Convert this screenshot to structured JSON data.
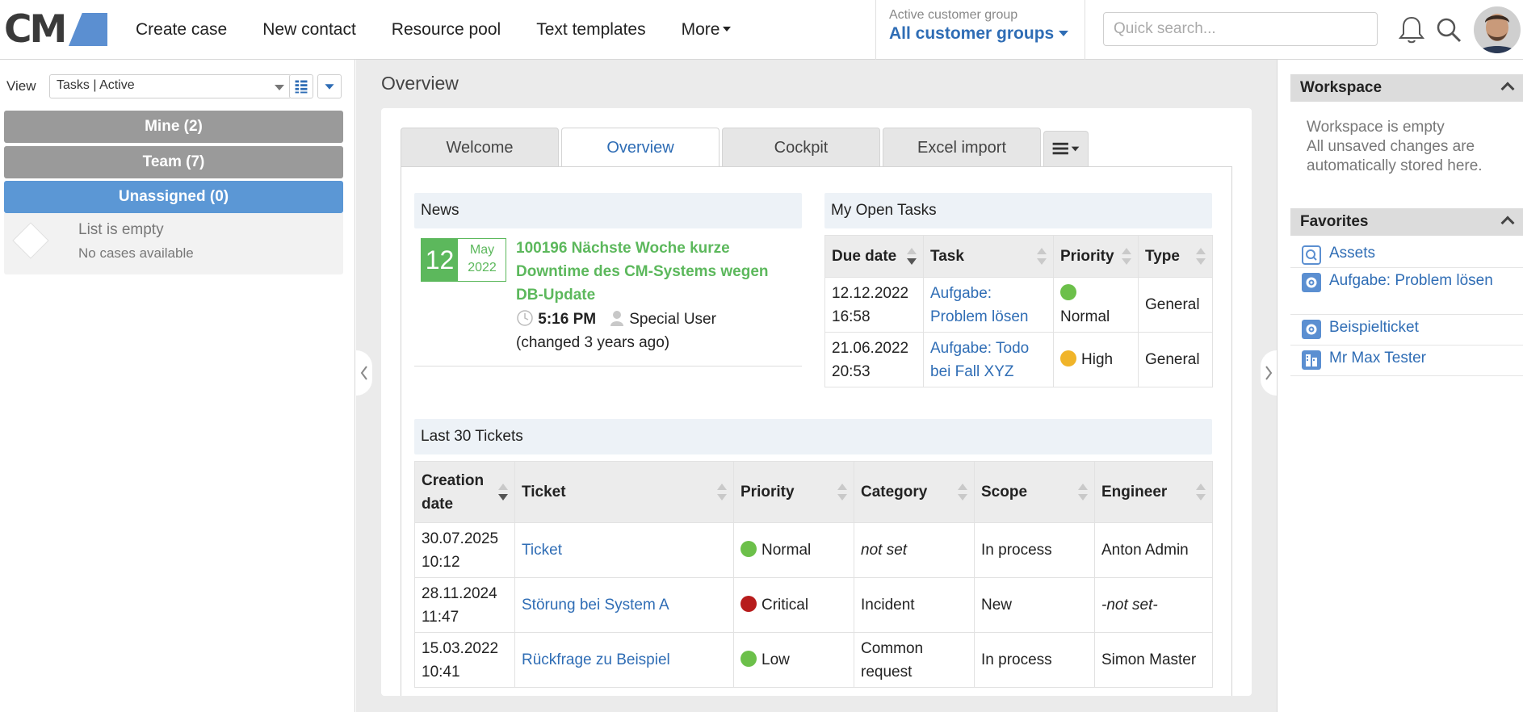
{
  "topbar": {
    "logo_text": "CM",
    "nav": [
      "Create case",
      "New contact",
      "Resource pool",
      "Text templates",
      "More"
    ],
    "customer_group": {
      "label": "Active customer group",
      "value": "All customer groups"
    },
    "search_placeholder": "Quick search..."
  },
  "left": {
    "view_label": "View",
    "view_value": "Tasks | Active",
    "groups": [
      "Mine (2)",
      "Team (7)",
      "Unassigned (0)"
    ],
    "empty_title": "List is empty",
    "empty_sub": "No cases available"
  },
  "center": {
    "title": "Overview",
    "tabs": [
      "Welcome",
      "Overview",
      "Cockpit",
      "Excel import"
    ],
    "active_tab": "Overview",
    "news": {
      "header": "News",
      "day": "12",
      "month": "May",
      "year": "2022",
      "title": "100196 Nächste Woche kurze Downtime des CM-Systems wegen DB-Update",
      "time": "5:16 PM",
      "user": "Special User",
      "changed": "(changed 3 years ago)"
    },
    "open_tasks": {
      "header": "My Open Tasks",
      "columns": [
        "Due date",
        "Task",
        "Priority",
        "Type"
      ],
      "rows": [
        {
          "due": "12.12.2022 16:58",
          "task": "Aufgabe: Problem lösen",
          "priority": "Normal",
          "type": "General"
        },
        {
          "due": "21.06.2022 20:53",
          "task": "Aufgabe: Todo bei Fall XYZ",
          "priority": "High",
          "type": "General"
        }
      ]
    },
    "tickets": {
      "header": "Last 30 Tickets",
      "columns": [
        "Creation date",
        "Ticket",
        "Priority",
        "Category",
        "Scope",
        "Engineer"
      ],
      "rows": [
        {
          "date": "30.07.2025 10:12",
          "ticket": "Ticket",
          "priority": "Normal",
          "category": "not set",
          "scope": "In process",
          "engineer": "Anton Admin"
        },
        {
          "date": "28.11.2024 11:47",
          "ticket": "Störung bei System A",
          "priority": "Critical",
          "category": "Incident",
          "scope": "New",
          "engineer": "-not set-"
        },
        {
          "date": "15.03.2022 10:41",
          "ticket": "Rückfrage zu Beispiel",
          "priority": "Low",
          "category": "Common request",
          "scope": "In process",
          "engineer": "Simon Master"
        }
      ]
    }
  },
  "right": {
    "workspace": {
      "header": "Workspace",
      "line1": "Workspace is empty",
      "line2": "All unsaved changes are automatically stored here."
    },
    "favorites": {
      "header": "Favorites",
      "items": [
        "Assets",
        "Aufgabe: Problem lösen",
        "Beispielticket",
        "Mr Max Tester"
      ]
    }
  },
  "colors": {
    "accent": "#2f6db5",
    "green": "#5cb85c",
    "priority_normal": "#6cc04a",
    "priority_high": "#f0b429",
    "priority_critical": "#b71c1c",
    "priority_low": "#6cc04a"
  }
}
